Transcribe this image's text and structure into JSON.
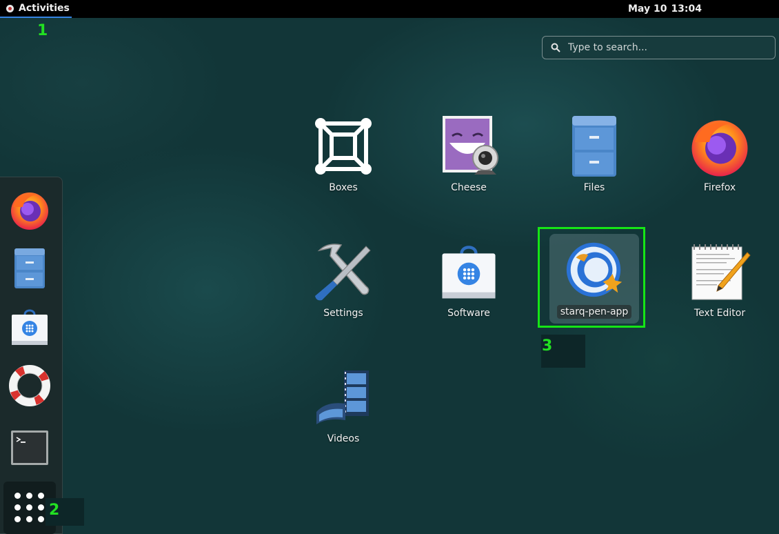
{
  "topbar": {
    "activities_label": "Activities",
    "date": "May 10",
    "time": "13:04"
  },
  "markers": [
    "1",
    "2",
    "3"
  ],
  "search": {
    "placeholder": "Type to search...",
    "value": ""
  },
  "dash": {
    "items": [
      {
        "name": "Firefox",
        "icon": "firefox-icon"
      },
      {
        "name": "Files",
        "icon": "file-cabinet-icon"
      },
      {
        "name": "Software",
        "icon": "shopping-bag-icon"
      },
      {
        "name": "Help",
        "icon": "lifebuoy-icon"
      },
      {
        "name": "Terminal",
        "icon": "terminal-icon"
      }
    ],
    "show_apps_icon": "app-grid-icon"
  },
  "apps": [
    {
      "label": "Boxes",
      "icon": "boxes-icon"
    },
    {
      "label": "Cheese",
      "icon": "cheese-webcam-icon"
    },
    {
      "label": "Files",
      "icon": "file-cabinet-icon"
    },
    {
      "label": "Firefox",
      "icon": "firefox-icon"
    },
    {
      "label": "Settings",
      "icon": "wrench-screwdriver-icon"
    },
    {
      "label": "Software",
      "icon": "shopping-bag-icon"
    },
    {
      "label": "starq-pen-app",
      "icon": "starq-pen-icon",
      "selected": true
    },
    {
      "label": "Text Editor",
      "icon": "notepad-pencil-icon"
    },
    {
      "label": "Videos",
      "icon": "film-reel-icon"
    }
  ],
  "colors": {
    "accent": "#3584e4",
    "highlight": "#16e516",
    "background": "#123638"
  }
}
